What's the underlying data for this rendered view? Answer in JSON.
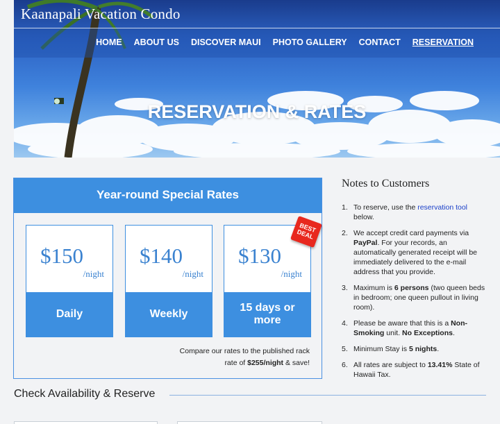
{
  "site": {
    "title": "Kaanapali Vacation Condo"
  },
  "nav": {
    "items": [
      {
        "label": "HOME"
      },
      {
        "label": "ABOUT US"
      },
      {
        "label": "DISCOVER MAUI"
      },
      {
        "label": "PHOTO GALLERY"
      },
      {
        "label": "CONTACT"
      },
      {
        "label": "RESERVATION"
      }
    ],
    "active": "RESERVATION"
  },
  "hero": {
    "heading": "RESERVATION & RATES"
  },
  "rates": {
    "title": "Year-round Special Rates",
    "cards": [
      {
        "price": "$150",
        "per": "/night",
        "label": "Daily"
      },
      {
        "price": "$140",
        "per": "/night",
        "label": "Weekly"
      },
      {
        "price": "$130",
        "per": "/night",
        "label": "15 days or more",
        "badge_line1": "BEST",
        "badge_line2": "DEAL"
      }
    ],
    "compare_pre": "Compare our rates to the published rack rate of ",
    "compare_bold": "$255/night",
    "compare_post": " & save!"
  },
  "notes": {
    "title": "Notes to Customers",
    "items": [
      {
        "num": "1.",
        "pre": "To reserve, use the ",
        "link": "reservation tool",
        "post": " below."
      },
      {
        "num": "2.",
        "pre": "We accept credit card payments via ",
        "bold": "PayPal",
        "post": ". For your records, an automatically generated receipt will be immediately delivered to the e-mail address that you provide."
      },
      {
        "num": "3.",
        "pre": "Maximum is ",
        "bold": "6 persons",
        "post": " (two queen beds in bedroom; one queen pullout in living room)."
      },
      {
        "num": "4.",
        "pre": "Please be aware that this is a ",
        "bold": "Non-Smoking",
        "post": " unit. ",
        "bold2": "No Exceptions",
        "post2": "."
      },
      {
        "num": "5.",
        "pre": "Minimum Stay is ",
        "bold": "5 nights",
        "post": "."
      },
      {
        "num": "6.",
        "pre": "All rates are subject to ",
        "bold": "13.41%",
        "post": " State of Hawaii Tax."
      }
    ]
  },
  "check": {
    "title": "Check Availability & Reserve"
  },
  "colors": {
    "accent": "#3d8fe0",
    "badge": "#e8281e",
    "link": "#1a3fc8"
  },
  "icons": [
    "palm-tree-image",
    "cloud-image",
    "best-deal-badge"
  ]
}
